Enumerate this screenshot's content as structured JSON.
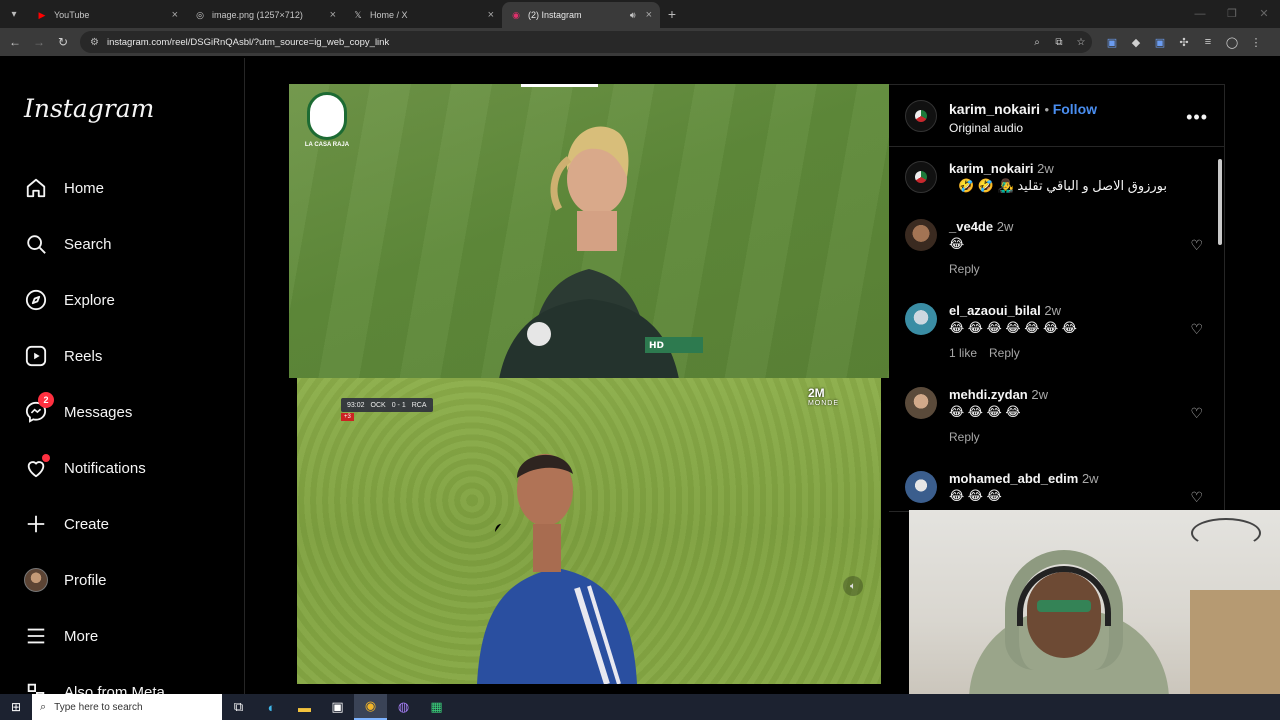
{
  "browser": {
    "tabs": [
      {
        "title": "YouTube",
        "icon": "youtube-icon",
        "active": false
      },
      {
        "title": "image.png (1257×712)",
        "icon": "globe-icon",
        "active": false
      },
      {
        "title": "Home / X",
        "icon": "x-icon",
        "active": false
      },
      {
        "title": "(2) Instagram",
        "icon": "instagram-icon",
        "active": true
      }
    ],
    "url": "instagram.com/reel/DSGiRnQAsbl/?utm_source=ig_web_copy_link"
  },
  "sidebar": {
    "logo": "Instagram",
    "items": [
      {
        "label": "Home",
        "icon": "home-icon"
      },
      {
        "label": "Search",
        "icon": "search-icon"
      },
      {
        "label": "Explore",
        "icon": "compass-icon"
      },
      {
        "label": "Reels",
        "icon": "reels-icon"
      },
      {
        "label": "Messages",
        "icon": "messenger-icon",
        "badge": "2"
      },
      {
        "label": "Notifications",
        "icon": "heart-icon"
      },
      {
        "label": "Create",
        "icon": "plus-icon"
      },
      {
        "label": "Profile",
        "icon": "avatar"
      },
      {
        "label": "More",
        "icon": "hamburger-icon"
      },
      {
        "label": "Also from Meta",
        "icon": "meta-icon"
      }
    ]
  },
  "reel": {
    "watermark": "LA CASA RAJA",
    "scorebug": {
      "time": "93:02",
      "home": "OCK",
      "score": "0 - 1",
      "away": "RCA",
      "added": "+3"
    },
    "channel": {
      "name": "2M",
      "sub": "MONDE"
    }
  },
  "panel": {
    "author": "karim_nokairi",
    "follow": "Follow",
    "audio": "Original audio",
    "caption": {
      "user": "karim_nokairi",
      "time": "2w",
      "text": "بورزوق الاصل و الباقي تقليد 👨‍🎤 🤣 🤣"
    },
    "comments": [
      {
        "user": "_ve4de",
        "time": "2w",
        "text": "😂",
        "likes": "",
        "reply": "Reply"
      },
      {
        "user": "el_azaoui_bilal",
        "time": "2w",
        "text": "😂 😂 😂 😂 😂 😂 😂",
        "likes": "1 like",
        "reply": "Reply"
      },
      {
        "user": "mehdi.zydan",
        "time": "2w",
        "text": "😂 😂 😂 😂",
        "likes": "",
        "reply": "Reply"
      },
      {
        "user": "mohamed_abd_edim",
        "time": "2w",
        "text": "😂 😂 😂",
        "likes": "",
        "reply": ""
      }
    ]
  },
  "taskbar": {
    "search_placeholder": "Type here to search"
  },
  "colors": {
    "follow_blue": "#4a8ef0",
    "badge_red": "#ff3040"
  }
}
